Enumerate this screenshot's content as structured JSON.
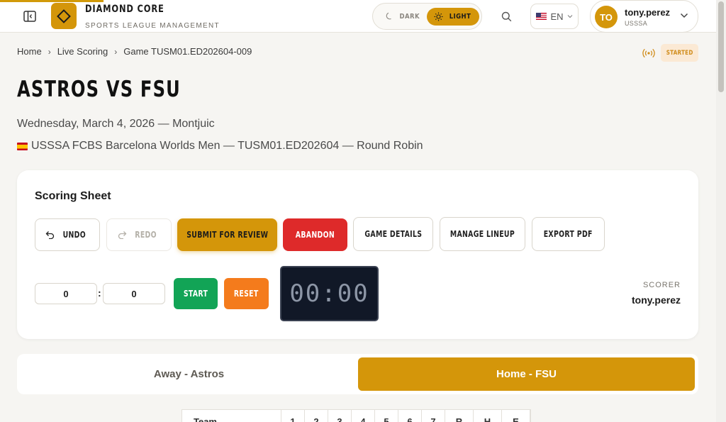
{
  "brand": {
    "name": "DIAMOND CORE",
    "subtitle": "SPORTS LEAGUE MANAGEMENT",
    "accent_color": "#d4960a"
  },
  "header": {
    "theme": {
      "dark_label": "DARK",
      "light_label": "LIGHT",
      "active": "light"
    },
    "language": {
      "label": "EN",
      "flag": "us-flag-icon"
    },
    "user": {
      "initials": "TO",
      "name": "tony.perez",
      "org": "USSSA"
    }
  },
  "breadcrumb": {
    "items": [
      "Home",
      "Live Scoring",
      "Game TUSM01.ED202604-009"
    ],
    "separator": "›"
  },
  "status": {
    "label": "STARTED",
    "icon": "live-broadcast-icon",
    "color": "#d08c1a"
  },
  "game": {
    "title": "ASTROS VS FSU",
    "date_line": "Wednesday, March 4, 2026 — Montjuic",
    "meta_line": "USSSA FCBS Barcelona Worlds Men — TUSM01.ED202604 — Round Robin",
    "flag": "spain-flag-icon"
  },
  "scoring_sheet": {
    "title": "Scoring Sheet",
    "buttons": {
      "undo": "UNDO",
      "redo": "REDO",
      "submit": "SUBMIT FOR REVIEW",
      "abandon": "ABANDON",
      "game_details": "GAME DETAILS",
      "manage_lineup": "MANAGE LINEUP",
      "export_pdf": "EXPORT PDF"
    },
    "timer": {
      "minutes": "0",
      "seconds": "0",
      "separator": ":",
      "start_label": "START",
      "reset_label": "RESET",
      "display": "00:00"
    },
    "scorer": {
      "label": "SCORER",
      "name": "tony.perez"
    }
  },
  "team_tabs": {
    "away": "Away - Astros",
    "home": "Home - FSU",
    "active": "home"
  },
  "scoreboard": {
    "headers": [
      "Team",
      "1",
      "2",
      "3",
      "4",
      "5",
      "6",
      "7",
      "R",
      "H",
      "E"
    ]
  }
}
